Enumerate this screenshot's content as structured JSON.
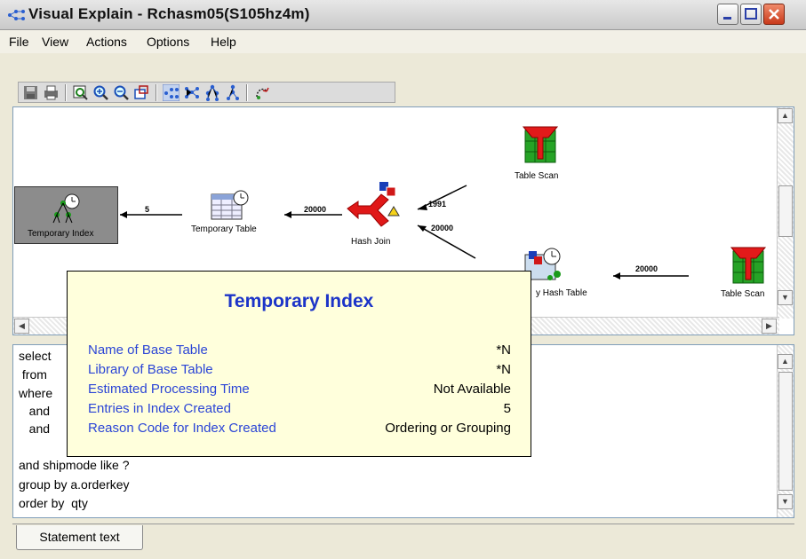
{
  "window": {
    "title": "Visual Explain - Rchasm05(S105hz4m)"
  },
  "menu": {
    "items": [
      {
        "label": "File"
      },
      {
        "label": "View"
      },
      {
        "label": "Actions"
      },
      {
        "label": "Options"
      },
      {
        "label": "Help"
      }
    ]
  },
  "toolbar": {
    "buttons": [
      {
        "icon": "save-icon"
      },
      {
        "icon": "print-icon"
      },
      {
        "icon": "zoom-to-fit-icon"
      },
      {
        "icon": "zoom-in-icon"
      },
      {
        "icon": "zoom-out-icon"
      },
      {
        "icon": "overview-icon"
      },
      {
        "icon": "horizontal-graph-icon"
      },
      {
        "icon": "vertical-graph-icon"
      },
      {
        "icon": "tree-icon"
      },
      {
        "icon": "hierarchy-icon"
      },
      {
        "icon": "refresh-icon"
      }
    ]
  },
  "diagram": {
    "nodes": {
      "temporary_index": "Temporary Index",
      "temporary_table": "Temporary Table",
      "hash_join": "Hash Join",
      "table_scan_top": "Table Scan",
      "temporary_hash_table": "y Hash Table",
      "table_scan_right": "Table Scan"
    },
    "edges": {
      "index_table": "5",
      "table_join": "20000",
      "scan_join": "1991",
      "hash_join": "20000",
      "scan_hash": "20000"
    }
  },
  "statement": {
    "lines": [
      "select",
      " from",
      "where",
      "   and",
      "   and",
      "and shipmode like ?",
      "group by a.orderkey",
      "order by  qty"
    ]
  },
  "tabs": {
    "statement_text": "Statement text"
  },
  "tooltip": {
    "title": "Temporary Index",
    "rows": [
      {
        "label": "Name of Base Table",
        "value": "*N"
      },
      {
        "label": "Library of Base Table",
        "value": "*N"
      },
      {
        "label": "Estimated Processing Time",
        "value": "Not Available"
      },
      {
        "label": "Entries in Index Created",
        "value": "5"
      },
      {
        "label": "Reason Code for Index Created",
        "value": "Ordering or Grouping"
      }
    ]
  }
}
